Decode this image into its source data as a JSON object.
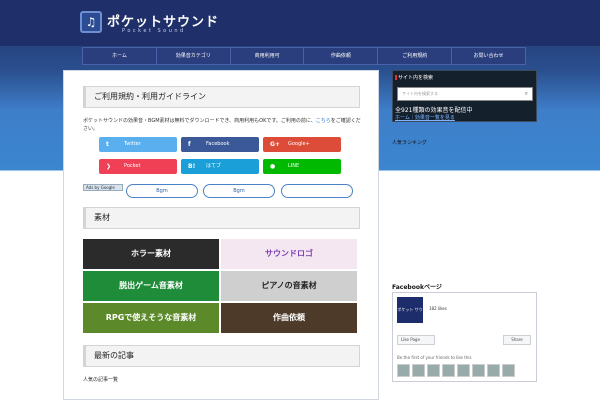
{
  "header": {
    "logo_icon": "♫",
    "title": "ポケットサウンド",
    "subtitle": "Pocket Sound"
  },
  "nav": [
    "ホーム",
    "効果音カテゴリ",
    "商用利用可",
    "作曲依頼",
    "ご利用規約",
    "お問い合わせ"
  ],
  "main": {
    "heading": "ご利用規約・利用ガイドライン",
    "intro": "ポケットサウンドの効果音・BGM素材は無料でダウンロードでき、商用利用もOKです。ご利用の前に、",
    "intro_link": "こちら",
    "intro_end": "をご確認ください。",
    "share": [
      {
        "label": "Twitter",
        "icon": "t",
        "color": "#5ab0ee"
      },
      {
        "label": "Facebook",
        "icon": "f",
        "color": "#3b5998"
      },
      {
        "label": "Google+",
        "icon": "G+",
        "color": "#dd4b39"
      },
      {
        "label": "Pocket",
        "icon": "❯",
        "color": "#ef4056"
      },
      {
        "label": "はてブ",
        "icon": "B!",
        "color": "#1a9fd9"
      },
      {
        "label": "LINE",
        "icon": "●",
        "color": "#00b900"
      }
    ],
    "ads_label": "Ads by Google",
    "tags": [
      "Bgm",
      "Bgm",
      ""
    ],
    "section_heading": "素材",
    "tiles": [
      {
        "label": "ホラー素材",
        "bg": "#2b2b2b"
      },
      {
        "label": "サウンドロゴ",
        "bg": "#f4e7f2"
      },
      {
        "label": "脱出ゲーム音素材",
        "bg": "#1f8c3a"
      },
      {
        "label": "ピアノの音素材",
        "bg": "#cfcfcf"
      },
      {
        "label": "RPGで使えそうな音素材",
        "bg": "#5c8a2b"
      },
      {
        "label": "作曲依頼",
        "bg": "#4d3a28"
      }
    ],
    "footer_heading": "最新の記事",
    "footer_text": "人気の記事一覧"
  },
  "sidebar": {
    "search_title": "サイト内を検索",
    "search_placeholder": "サイト内を検索する",
    "search_icon": "search-icon",
    "line1": "全921種類の効果音を配信中",
    "line2": "ホーム｜効果音一覧を見る",
    "label2": "人気ランキング",
    "fb_heading": "Facebookページ",
    "fb_logo": "ポケット サウンド",
    "fb_likes": "182 likes",
    "fb_like_btn": "Like Page",
    "fb_share_btn": "Share",
    "fb_friends": "Be the first of your friends to like this"
  }
}
